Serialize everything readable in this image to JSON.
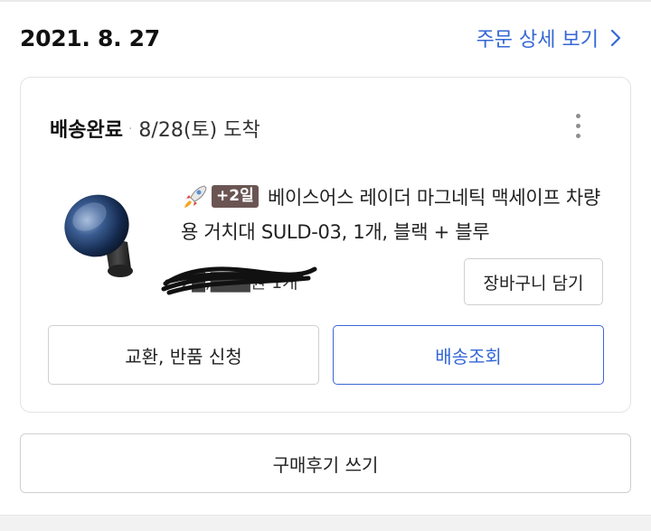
{
  "order": {
    "date": "2021. 8. 27",
    "detail_link_label": "주문 상세 보기"
  },
  "shipment": {
    "status": "배송완료",
    "separator": "·",
    "arrival": "8/28(토) 도착"
  },
  "product": {
    "delivery_badge": "+2일",
    "name": "베이스어스 레이더 마그네틱 맥세이프 차량용 거치대 SULD-03, 1개, 블랙 + 블루",
    "quantity": "1개",
    "price_hidden": "2█,███원"
  },
  "buttons": {
    "cart": "장바구니 담기",
    "return": "교환, 반품 신청",
    "tracking": "배송조회",
    "review": "구매후기 쓰기"
  },
  "icons": {
    "more": "more-vertical-icon",
    "detail": "chevron-right-icon",
    "rocket": "rocket-icon"
  },
  "colors": {
    "link_blue": "#3467d6",
    "badge_bg": "#6a5553",
    "border": "#cfcfcf"
  }
}
